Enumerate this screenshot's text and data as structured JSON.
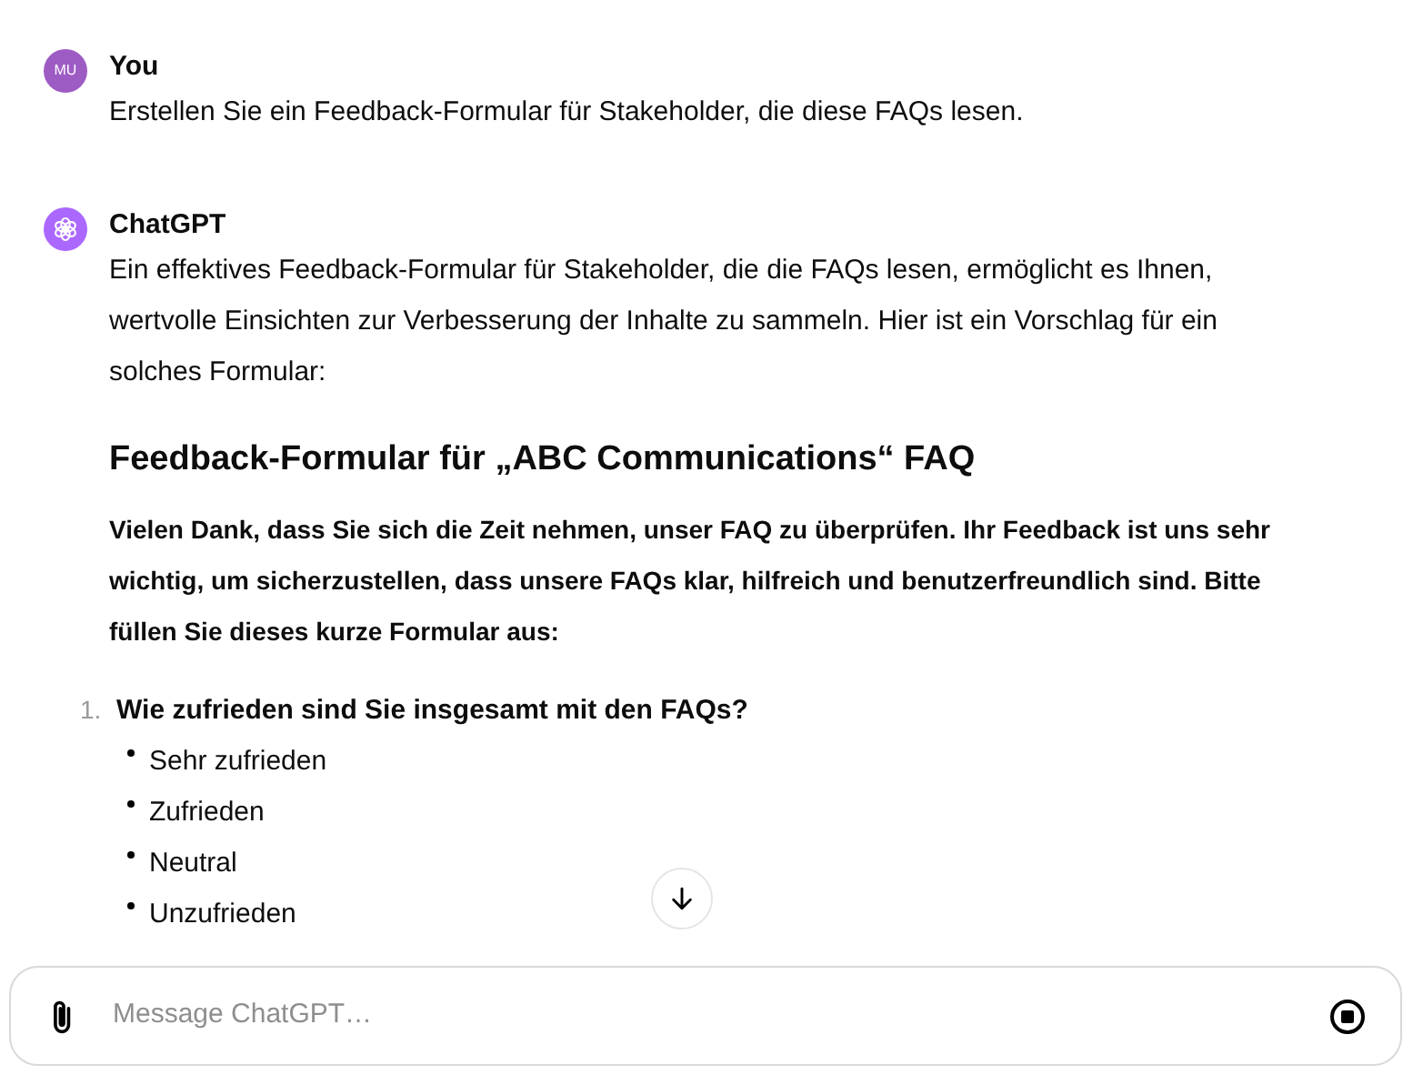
{
  "messages": [
    {
      "kind": "user",
      "avatar": "MU",
      "author": "You",
      "paragraphs": [
        "Erstellen Sie ein Feedback-Formular für Stakeholder, die diese FAQs lesen."
      ]
    },
    {
      "kind": "assistant",
      "author": "ChatGPT",
      "paragraphs": [
        "Ein effektives Feedback-Formular für Stakeholder, die die FAQs lesen, ermöglicht es Ihnen, wertvolle Einsichten zur Verbesserung der Inhalte zu sammeln. Hier ist ein Vorschlag für ein solches Formular:"
      ],
      "heading": "Feedback-Formular für „ABC Communications“ FAQ",
      "intro": "Vielen Dank, dass Sie sich die Zeit nehmen, unser FAQ zu überprüfen. Ihr Feedback ist uns sehr wichtig, um sicherzustellen, dass unsere FAQs klar, hilfreich und benutzerfreundlich sind. Bitte füllen Sie dieses kurze Formular aus:",
      "questions": [
        {
          "number": "1.",
          "text": "Wie zufrieden sind Sie insgesamt mit den FAQs?",
          "options": [
            "Sehr zufrieden",
            "Zufrieden",
            "Neutral",
            "Unzufrieden"
          ]
        }
      ]
    }
  ],
  "composer": {
    "placeholder": "Message ChatGPT…"
  }
}
